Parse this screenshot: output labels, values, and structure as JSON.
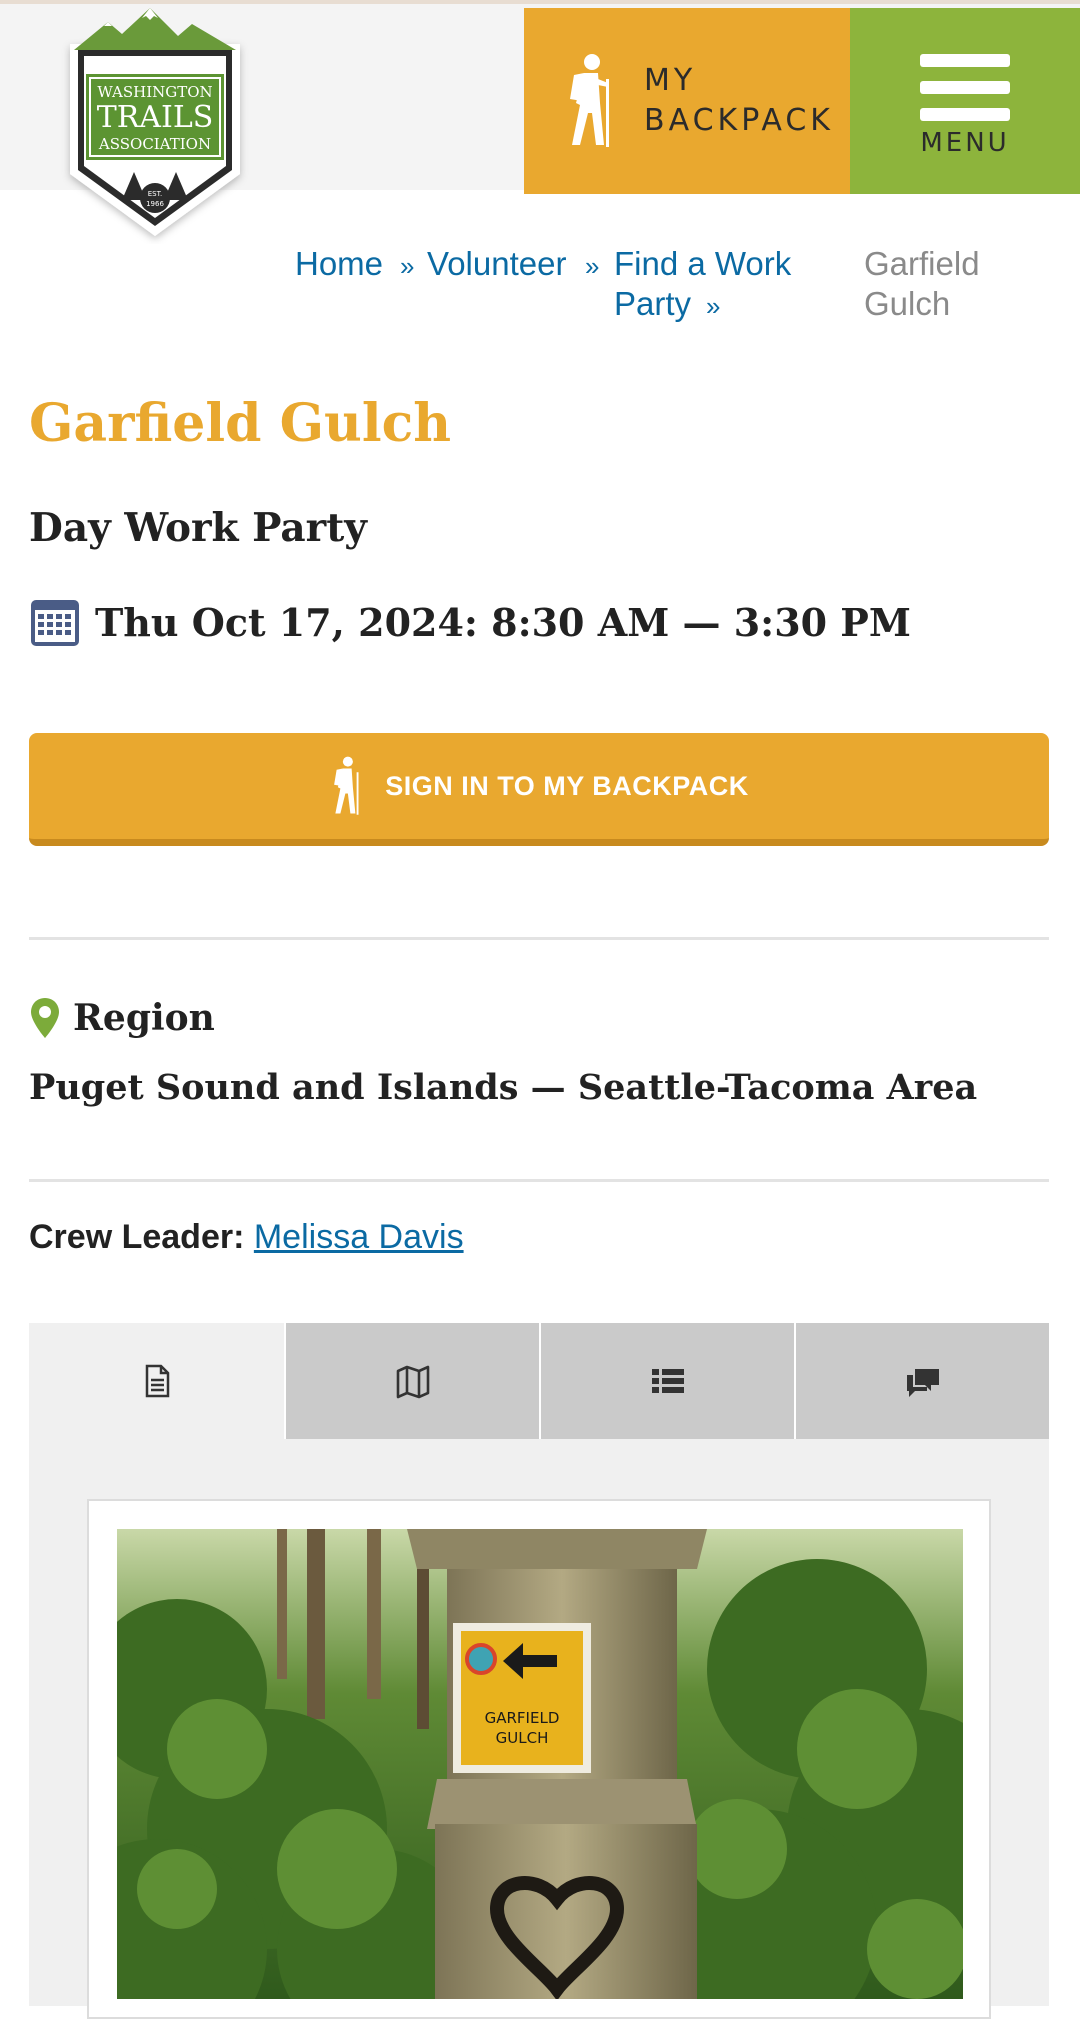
{
  "header": {
    "logo_text_top": "WASHINGTON",
    "logo_text_mid": "TRAILS",
    "logo_text_bottom": "ASSOCIATION",
    "logo_est": "EST.",
    "logo_year": "1966",
    "backpack_line1": "MY",
    "backpack_line2": "BACKPACK",
    "menu_label": "MENU",
    "accent_color": "#e9a82f",
    "menu_color": "#8db43c"
  },
  "breadcrumb": {
    "home": "Home",
    "volunteer": "Volunteer",
    "find_line1": "Find a Work",
    "find_line2": "Party",
    "current_line1": "Garfield",
    "current_line2": "Gulch",
    "separator": "»"
  },
  "event": {
    "title": "Garfield Gulch",
    "type": "Day Work Party",
    "date": "Thu Oct 17, 2024: 8:30 AM — 3:30 PM"
  },
  "signin": {
    "label": "SIGN IN TO MY BACKPACK"
  },
  "region": {
    "label": "Region",
    "value": "Puget Sound and Islands — Seattle-Tacoma Area"
  },
  "crew": {
    "label": "Crew Leader:",
    "name": "Melissa Davis"
  },
  "tabs": [
    {
      "icon": "document-icon",
      "active": true
    },
    {
      "icon": "map-icon",
      "active": false
    },
    {
      "icon": "list-icon",
      "active": false
    },
    {
      "icon": "comments-icon",
      "active": false
    }
  ],
  "photo": {
    "sign_line1": "GARFIELD",
    "sign_line2": "GULCH"
  }
}
